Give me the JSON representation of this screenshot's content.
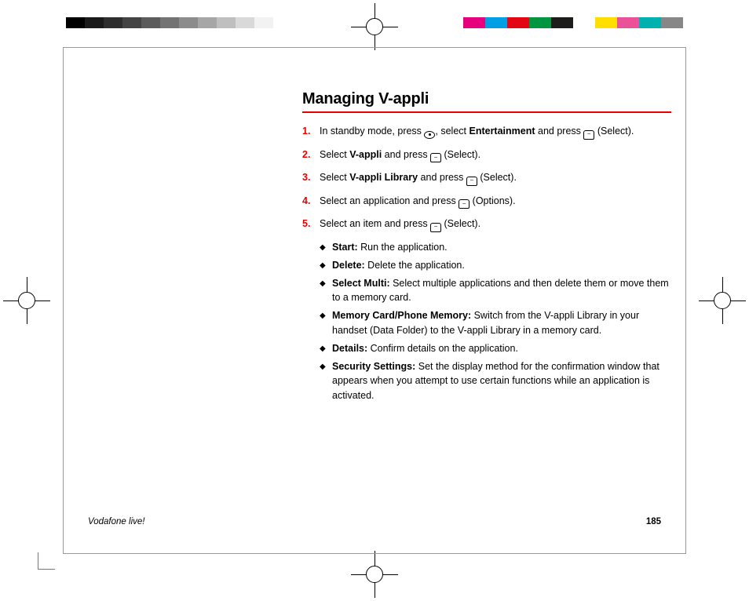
{
  "title": "Managing V-appli",
  "steps": [
    {
      "num": "1.",
      "pre": "In standby mode, press ",
      "key1": "dot",
      "mid": ", select ",
      "bold1": "Entertainment",
      "mid2": " and press ",
      "key2": "soft",
      "post": " (Select)."
    },
    {
      "num": "2.",
      "pre": "Select ",
      "bold1": "V-appli",
      "mid": " and press ",
      "key1": "soft",
      "post": " (Select)."
    },
    {
      "num": "3.",
      "pre": "Select ",
      "bold1": "V-appli Library",
      "mid": " and press ",
      "key1": "soft",
      "post": " (Select)."
    },
    {
      "num": "4.",
      "pre": "Select an application and press ",
      "key1": "soft",
      "post": " (Options)."
    },
    {
      "num": "5.",
      "pre": "Select an item and press ",
      "key1": "soft",
      "post": " (Select)."
    }
  ],
  "bullets": [
    {
      "label": "Start:",
      "text": " Run the application."
    },
    {
      "label": "Delete:",
      "text": " Delete the application."
    },
    {
      "label": "Select Multi:",
      "text": " Select multiple applications and then delete them or move them to a memory card."
    },
    {
      "label": "Memory Card/Phone Memory:",
      "text": " Switch from the V-appli Library in your handset (Data Folder) to the V-appli Library in a memory card."
    },
    {
      "label": "Details:",
      "text": " Confirm details on the application."
    },
    {
      "label": "Security Settings:",
      "text": " Set the display method for the confirmation window that appears when you attempt to use certain functions while an application is activated."
    }
  ],
  "footer": {
    "left": "Vodafone live!",
    "right": "185"
  }
}
